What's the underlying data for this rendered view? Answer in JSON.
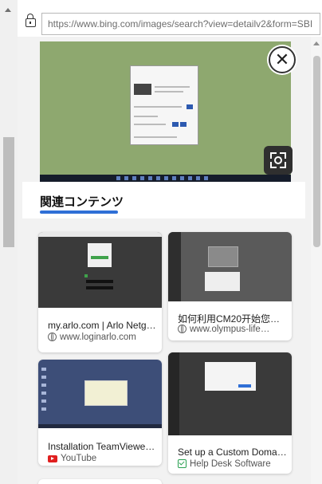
{
  "address_bar": {
    "url": "https://www.bing.com/images/search?view=detailv2&form=SBI"
  },
  "viewer": {
    "close_symbol": "✕",
    "close_icon": "close-icon",
    "visual_search_icon": "visual-search-icon"
  },
  "related": {
    "heading": "関連コンテンツ",
    "accent_color": "#2f6fd6"
  },
  "cards": [
    {
      "title": "my.arlo.com | Arlo Netge…",
      "source": "www.loginarlo.com",
      "source_icon": "globe-icon"
    },
    {
      "title": "如何利用CM20开始您的…",
      "source": "www.olympus-life…",
      "source_icon": "globe-icon"
    },
    {
      "title": "Installation TeamViewer …",
      "source": "YouTube",
      "source_icon": "youtube-icon"
    },
    {
      "title": "Set up a Custom Domai…",
      "source": "Help Desk Software",
      "source_icon": "check-icon"
    }
  ]
}
